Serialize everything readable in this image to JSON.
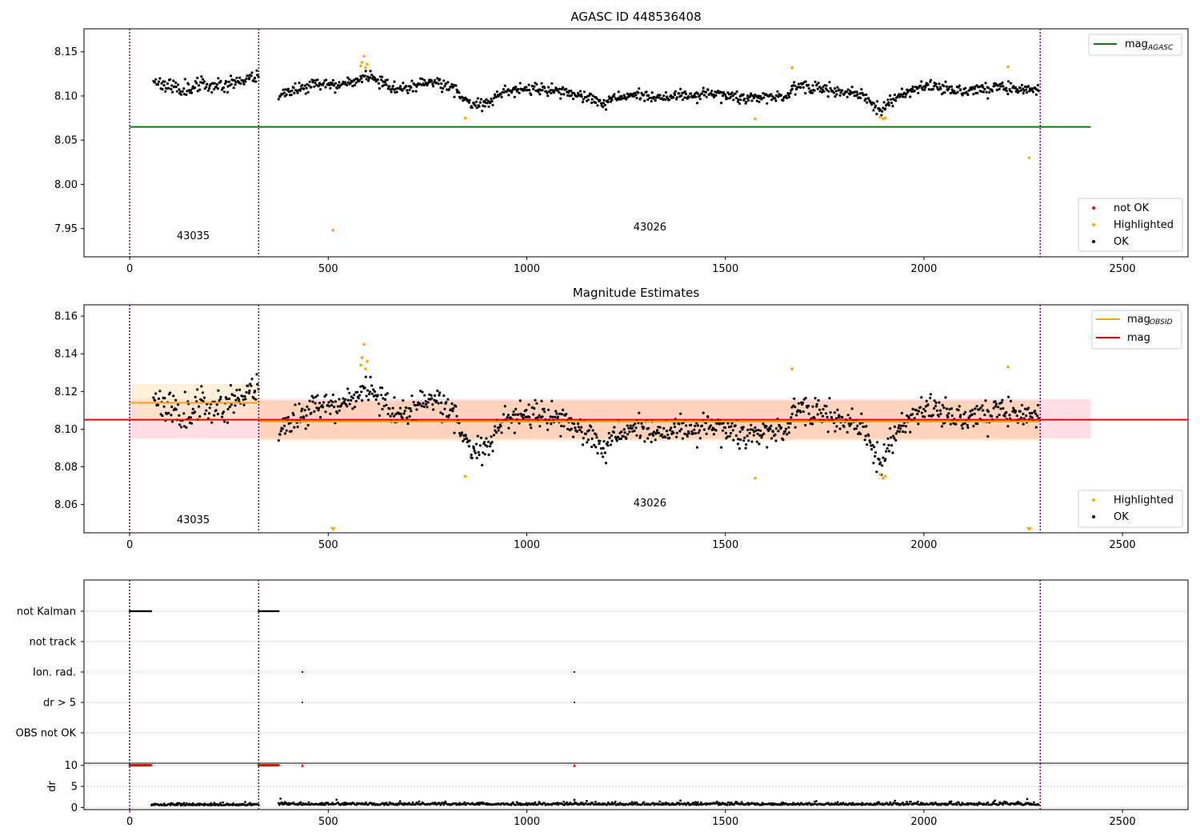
{
  "chart_data": [
    {
      "type": "scatter",
      "title": "AGASC ID 448536408",
      "xlim": [
        -115,
        2665
      ],
      "ylim": [
        7.918,
        8.176
      ],
      "xticks": [
        0,
        500,
        1000,
        1500,
        2000,
        2500
      ],
      "yticks": [
        7.95,
        8.0,
        8.05,
        8.1,
        8.15
      ],
      "ytick_labels": [
        "7.95",
        "8.00",
        "8.05",
        "8.10",
        "8.15"
      ],
      "obsid_boundaries": [
        0,
        325,
        2293
      ],
      "obsid_labels": [
        {
          "text": "43035",
          "x": 160,
          "y": 7.938
        },
        {
          "text": "43026",
          "x": 1310,
          "y": 7.948
        }
      ],
      "lines": [
        {
          "name": "mag_AGASC",
          "label_main": "mag",
          "label_sub": "AGASC",
          "color": "#008000",
          "y": 8.065,
          "x": [
            0,
            2420
          ]
        }
      ],
      "legend_lines_position": "upper right",
      "legend_points_position": "lower right",
      "legend_points": [
        {
          "label": "not OK",
          "color": "#ff0000"
        },
        {
          "label": "Highlighted",
          "color": "#ffa500"
        },
        {
          "label": "OK",
          "color": "#000000"
        }
      ],
      "segments": [
        {
          "x0": 60,
          "x1": 325,
          "step": 2,
          "knots": [
            [
              60,
              8.118
            ],
            [
              120,
              8.108
            ],
            [
              180,
              8.112
            ],
            [
              250,
              8.114
            ],
            [
              325,
              8.124
            ]
          ],
          "noise": 0.007,
          "seed": 11
        },
        {
          "x0": 375,
          "x1": 2290,
          "step": 2,
          "knots": [
            [
              375,
              8.1
            ],
            [
              430,
              8.108
            ],
            [
              460,
              8.115
            ],
            [
              520,
              8.11
            ],
            [
              580,
              8.118
            ],
            [
              600,
              8.126
            ],
            [
              650,
              8.11
            ],
            [
              700,
              8.108
            ],
            [
              760,
              8.118
            ],
            [
              820,
              8.108
            ],
            [
              860,
              8.088
            ],
            [
              900,
              8.093
            ],
            [
              950,
              8.105
            ],
            [
              1000,
              8.108
            ],
            [
              1100,
              8.105
            ],
            [
              1200,
              8.092
            ],
            [
              1250,
              8.1
            ],
            [
              1350,
              8.098
            ],
            [
              1450,
              8.103
            ],
            [
              1550,
              8.098
            ],
            [
              1650,
              8.1
            ],
            [
              1690,
              8.114
            ],
            [
              1750,
              8.108
            ],
            [
              1850,
              8.1
            ],
            [
              1890,
              8.082
            ],
            [
              1930,
              8.1
            ],
            [
              2000,
              8.112
            ],
            [
              2100,
              8.106
            ],
            [
              2200,
              8.11
            ],
            [
              2290,
              8.106
            ]
          ],
          "noise": 0.0055,
          "seed": 23
        }
      ],
      "highlighted": [
        [
          512,
          7.948
        ],
        [
          582,
          8.134
        ],
        [
          585,
          8.138
        ],
        [
          590,
          8.145
        ],
        [
          594,
          8.132
        ],
        [
          598,
          8.136
        ],
        [
          845,
          8.075
        ],
        [
          1575,
          8.074
        ],
        [
          1668,
          8.132
        ],
        [
          1890,
          8.076
        ],
        [
          1897,
          8.074
        ],
        [
          1903,
          8.075
        ],
        [
          2212,
          8.133
        ],
        [
          2265,
          8.03
        ]
      ]
    },
    {
      "type": "scatter",
      "title": "Magnitude Estimates",
      "xlim": [
        -115,
        2665
      ],
      "ylim": [
        8.045,
        8.166
      ],
      "xticks": [
        0,
        500,
        1000,
        1500,
        2000,
        2500
      ],
      "yticks": [
        8.06,
        8.08,
        8.1,
        8.12,
        8.14,
        8.16
      ],
      "ytick_labels": [
        "8.06",
        "8.08",
        "8.10",
        "8.12",
        "8.14",
        "8.16"
      ],
      "obsid_boundaries": [
        0,
        325,
        2293
      ],
      "obsid_labels": [
        {
          "text": "43035",
          "x": 160,
          "y": 8.05
        },
        {
          "text": "43026",
          "x": 1310,
          "y": 8.059
        }
      ],
      "bands": [
        {
          "x0": 0,
          "x1": 2420,
          "y0": 8.095,
          "y1": 8.116,
          "color": "#ffc0cb",
          "opacity": 0.5
        },
        {
          "x0": 0,
          "x1": 325,
          "y0": 8.104,
          "y1": 8.124,
          "color": "#ffe4b5",
          "opacity": 0.5
        },
        {
          "x0": 325,
          "x1": 2293,
          "y0": 8.094,
          "y1": 8.115,
          "color": "#ffc080",
          "opacity": 0.4
        }
      ],
      "lines": [
        {
          "name": "mag_OBSID_1",
          "label_main": "mag",
          "label_sub": "OBSID",
          "color": "#ffa500",
          "y": 8.114,
          "x": [
            0,
            325
          ]
        },
        {
          "name": "mag_OBSID_2",
          "label_main": "",
          "label_sub": "",
          "color": "#ffa500",
          "y": 8.104,
          "x": [
            325,
            2293
          ]
        },
        {
          "name": "mag",
          "label_main": "mag",
          "label_sub": "",
          "color": "#ff0000",
          "y": 8.105,
          "x": [
            -115,
            2665
          ]
        }
      ],
      "legend_lines_position": "upper right",
      "legend_points_position": "lower right",
      "legend_points": [
        {
          "label": "Highlighted",
          "color": "#ffa500"
        },
        {
          "label": "OK",
          "color": "#000000"
        }
      ],
      "segments": [
        {
          "x0": 60,
          "x1": 325,
          "step": 2,
          "knots": [
            [
              60,
              8.118
            ],
            [
              120,
              8.108
            ],
            [
              180,
              8.112
            ],
            [
              250,
              8.114
            ],
            [
              325,
              8.124
            ]
          ],
          "noise": 0.0075,
          "seed": 11
        },
        {
          "x0": 375,
          "x1": 2290,
          "step": 2,
          "knots": [
            [
              375,
              8.098
            ],
            [
              430,
              8.106
            ],
            [
              460,
              8.114
            ],
            [
              520,
              8.11
            ],
            [
              580,
              8.118
            ],
            [
              600,
              8.125
            ],
            [
              650,
              8.11
            ],
            [
              700,
              8.108
            ],
            [
              760,
              8.118
            ],
            [
              820,
              8.108
            ],
            [
              860,
              8.086
            ],
            [
              900,
              8.092
            ],
            [
              950,
              8.105
            ],
            [
              1000,
              8.108
            ],
            [
              1100,
              8.105
            ],
            [
              1200,
              8.09
            ],
            [
              1250,
              8.099
            ],
            [
              1350,
              8.098
            ],
            [
              1450,
              8.102
            ],
            [
              1550,
              8.097
            ],
            [
              1650,
              8.1
            ],
            [
              1690,
              8.114
            ],
            [
              1750,
              8.108
            ],
            [
              1850,
              8.1
            ],
            [
              1890,
              8.08
            ],
            [
              1930,
              8.1
            ],
            [
              2000,
              8.112
            ],
            [
              2100,
              8.106
            ],
            [
              2200,
              8.11
            ],
            [
              2290,
              8.106
            ]
          ],
          "noise": 0.006,
          "seed": 23
        }
      ],
      "highlighted": [
        [
          582,
          8.134
        ],
        [
          585,
          8.138
        ],
        [
          590,
          8.145
        ],
        [
          594,
          8.132
        ],
        [
          598,
          8.136
        ],
        [
          845,
          8.075
        ],
        [
          1575,
          8.074
        ],
        [
          1668,
          8.132
        ],
        [
          1890,
          8.076
        ],
        [
          1897,
          8.074
        ],
        [
          1903,
          8.075
        ],
        [
          2212,
          8.133
        ]
      ],
      "offscale_markers": [
        {
          "x": 512,
          "color": "#ffa500"
        },
        {
          "x": 2265,
          "color": "#ffa500"
        }
      ]
    },
    {
      "type": "scatter",
      "title": "",
      "xlim": [
        -115,
        2665
      ],
      "xticks": [
        0,
        500,
        1000,
        1500,
        2000,
        2500
      ],
      "obsid_boundaries": [
        0,
        325,
        2293
      ],
      "flag_rows": [
        "not Kalman",
        "not track",
        "Ion. rad.",
        "dr > 5",
        "OBS not OK"
      ],
      "flags": {
        "not Kalman": [
          [
            0,
            55
          ],
          [
            325,
            375
          ]
        ],
        "not track": [],
        "Ion. rad.": [
          [
            435,
            435
          ],
          [
            1120,
            1120
          ]
        ],
        "dr > 5": [
          [
            435,
            435
          ],
          [
            1120,
            1120
          ]
        ],
        "OBS not OK": []
      }
    },
    {
      "type": "scatter",
      "title": "",
      "ylabel": "dr",
      "xlim": [
        -115,
        2665
      ],
      "ylim": [
        -0.5,
        10.5
      ],
      "xticks": [
        0,
        500,
        1000,
        1500,
        2000,
        2500
      ],
      "yticks": [
        0,
        5,
        10
      ],
      "ytick_labels": [
        "0",
        "5",
        "10"
      ],
      "obsid_boundaries": [
        0,
        325,
        2293
      ],
      "red_at_10": [
        [
          0,
          55
        ],
        [
          325,
          375
        ],
        [
          435,
          435
        ],
        [
          1120,
          1120
        ]
      ],
      "dr_segments": [
        {
          "x0": 55,
          "x1": 325,
          "step": 2,
          "mean": 0.5,
          "noise": 0.35,
          "seed": 5
        },
        {
          "x0": 375,
          "x1": 2290,
          "step": 2,
          "mean": 0.6,
          "noise": 0.45,
          "seed": 9
        }
      ],
      "dr_outliers": [
        [
          380,
          2.1
        ],
        [
          1120,
          1.8
        ],
        [
          2260,
          2.0
        ]
      ]
    }
  ]
}
